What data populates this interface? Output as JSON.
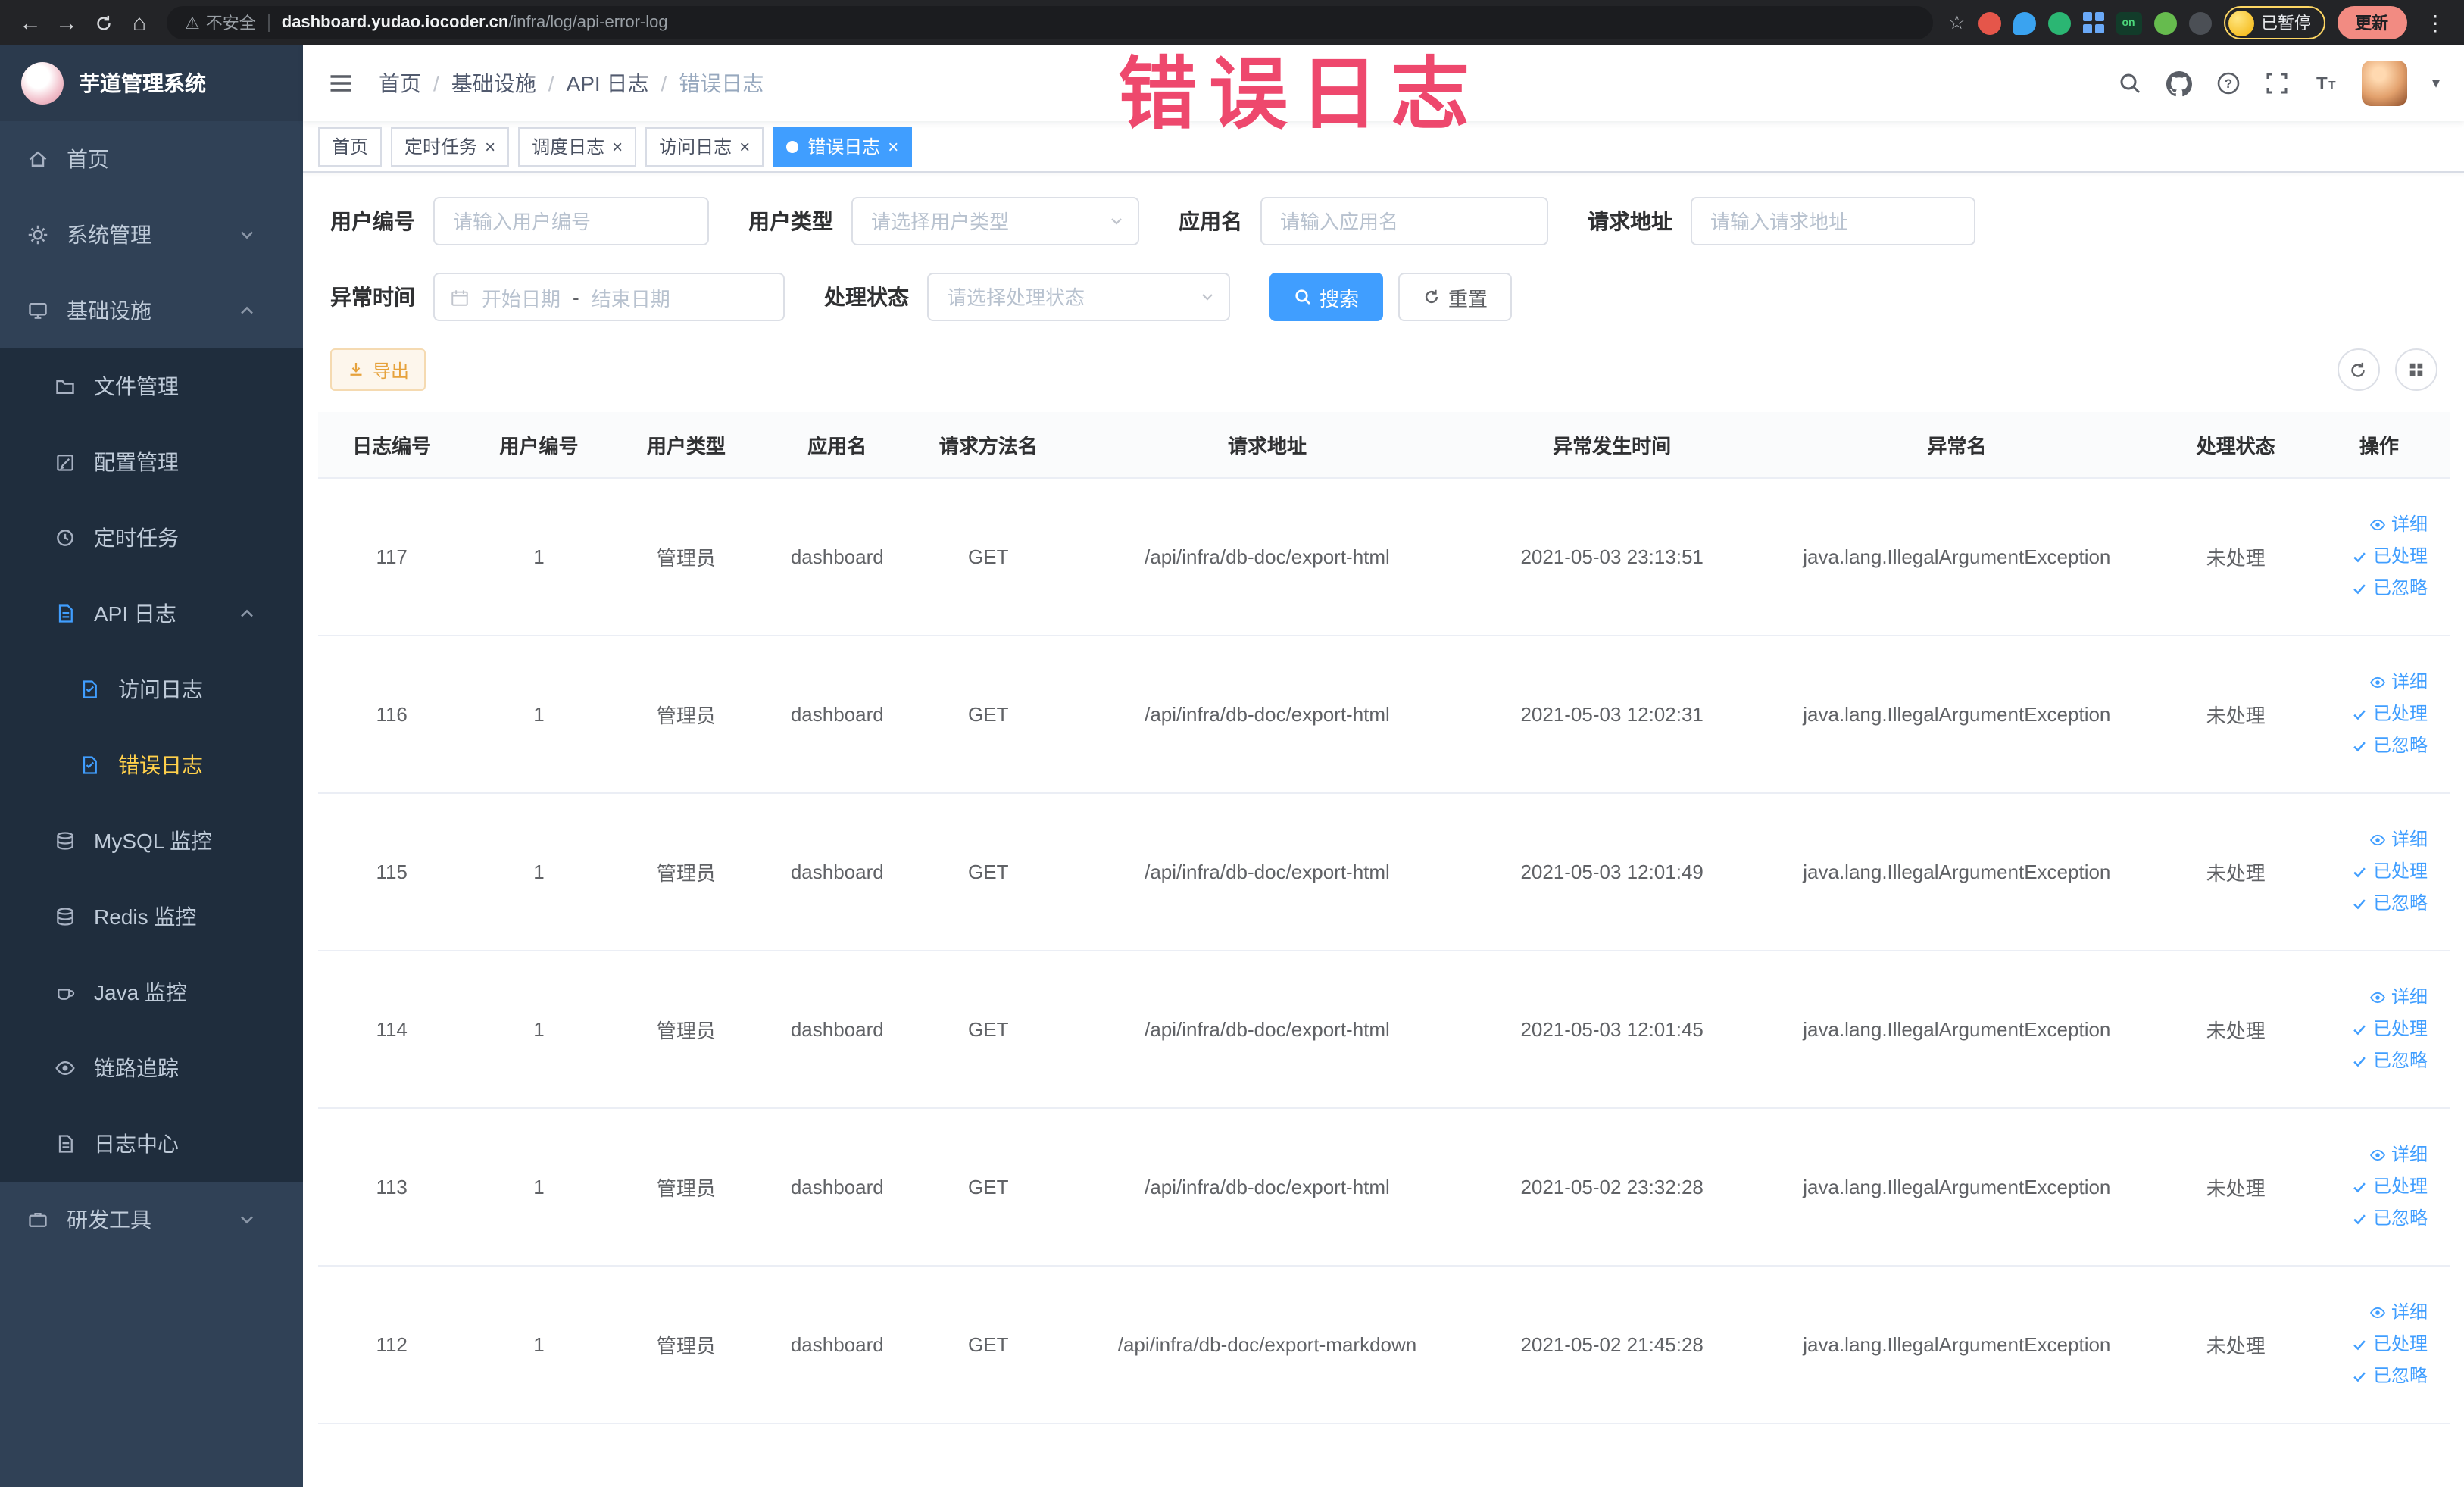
{
  "colors": {
    "primary": "#409EFF",
    "warning": "#E6A23C",
    "sidebar_bg": "#304156",
    "active_menu_text": "#ffd04b",
    "annotation": "#ED3B63",
    "tab_active_bg": "#409EFF"
  },
  "browser": {
    "not_secure": "不安全",
    "url_domain": "dashboard.yudao.iocoder.cn",
    "url_path": "/infra/log/api-error-log",
    "on_badge": "on",
    "paused_label": "已暂停",
    "update_label": "更新"
  },
  "overlay": {
    "text": "错误日志"
  },
  "sidebar": {
    "logo_title": "芋道管理系统",
    "items": [
      {
        "id": "home",
        "label": "首页",
        "icon": "home-icon",
        "level": 1
      },
      {
        "id": "system",
        "label": "系统管理",
        "icon": "gear-icon",
        "level": 1,
        "chevron": "down"
      },
      {
        "id": "infra",
        "label": "基础设施",
        "icon": "monitor-icon",
        "level": 1,
        "chevron": "up"
      },
      {
        "id": "file",
        "label": "文件管理",
        "icon": "folder-icon",
        "level": 2
      },
      {
        "id": "config",
        "label": "配置管理",
        "icon": "edit-icon",
        "level": 2
      },
      {
        "id": "job",
        "label": "定时任务",
        "icon": "clock-icon",
        "level": 2
      },
      {
        "id": "api-log",
        "label": "API 日志",
        "icon": "apidoc-icon",
        "level": 2,
        "chevron": "up",
        "blue": true
      },
      {
        "id": "access-log",
        "label": "访问日志",
        "icon": "doc-icon",
        "level": 3,
        "blue": true
      },
      {
        "id": "error-log",
        "label": "错误日志",
        "icon": "doc-icon",
        "level": 3,
        "blue": true,
        "active": true
      },
      {
        "id": "mysql",
        "label": "MySQL 监控",
        "icon": "db-icon",
        "level": 2
      },
      {
        "id": "redis",
        "label": "Redis 监控",
        "icon": "db-icon",
        "level": 2
      },
      {
        "id": "java",
        "label": "Java 监控",
        "icon": "coffee-icon",
        "level": 2
      },
      {
        "id": "trace",
        "label": "链路追踪",
        "icon": "eye-icon",
        "level": 2
      },
      {
        "id": "log-center",
        "label": "日志中心",
        "icon": "apidoc-icon",
        "level": 2
      },
      {
        "id": "devtools",
        "label": "研发工具",
        "icon": "briefcase-icon",
        "level": 1,
        "chevron": "down"
      }
    ]
  },
  "topbar": {
    "breadcrumb": [
      "首页",
      "基础设施",
      "API 日志",
      "错误日志"
    ]
  },
  "tabs": [
    {
      "label": "首页",
      "closable": false,
      "active": false
    },
    {
      "label": "定时任务",
      "closable": true,
      "active": false
    },
    {
      "label": "调度日志",
      "closable": true,
      "active": false
    },
    {
      "label": "访问日志",
      "closable": true,
      "active": false
    },
    {
      "label": "错误日志",
      "closable": true,
      "active": true
    }
  ],
  "filters": {
    "user_id": {
      "label": "用户编号",
      "placeholder": "请输入用户编号"
    },
    "user_type": {
      "label": "用户类型",
      "placeholder": "请选择用户类型"
    },
    "app_name": {
      "label": "应用名",
      "placeholder": "请输入应用名"
    },
    "request_url": {
      "label": "请求地址",
      "placeholder": "请输入请求地址"
    },
    "exception_time": {
      "label": "异常时间",
      "start_placeholder": "开始日期",
      "separator": "-",
      "end_placeholder": "结束日期"
    },
    "process_status": {
      "label": "处理状态",
      "placeholder": "请选择处理状态"
    },
    "search_button": "搜索",
    "reset_button": "重置"
  },
  "toolbar": {
    "export_button": "导出"
  },
  "table": {
    "columns": [
      "日志编号",
      "用户编号",
      "用户类型",
      "应用名",
      "请求方法名",
      "请求地址",
      "异常发生时间",
      "异常名",
      "处理状态",
      "操作"
    ],
    "action_labels": [
      "详细",
      "已处理",
      "已忽略"
    ],
    "rows": [
      {
        "id": "117",
        "user_id": "1",
        "user_type": "管理员",
        "app": "dashboard",
        "method": "GET",
        "url": "/api/infra/db-doc/export-html",
        "time": "2021-05-03 23:13:51",
        "exception": "java.lang.IllegalArgumentException",
        "status": "未处理"
      },
      {
        "id": "116",
        "user_id": "1",
        "user_type": "管理员",
        "app": "dashboard",
        "method": "GET",
        "url": "/api/infra/db-doc/export-html",
        "time": "2021-05-03 12:02:31",
        "exception": "java.lang.IllegalArgumentException",
        "status": "未处理"
      },
      {
        "id": "115",
        "user_id": "1",
        "user_type": "管理员",
        "app": "dashboard",
        "method": "GET",
        "url": "/api/infra/db-doc/export-html",
        "time": "2021-05-03 12:01:49",
        "exception": "java.lang.IllegalArgumentException",
        "status": "未处理"
      },
      {
        "id": "114",
        "user_id": "1",
        "user_type": "管理员",
        "app": "dashboard",
        "method": "GET",
        "url": "/api/infra/db-doc/export-html",
        "time": "2021-05-03 12:01:45",
        "exception": "java.lang.IllegalArgumentException",
        "status": "未处理"
      },
      {
        "id": "113",
        "user_id": "1",
        "user_type": "管理员",
        "app": "dashboard",
        "method": "GET",
        "url": "/api/infra/db-doc/export-html",
        "time": "2021-05-02 23:32:28",
        "exception": "java.lang.IllegalArgumentException",
        "status": "未处理"
      },
      {
        "id": "112",
        "user_id": "1",
        "user_type": "管理员",
        "app": "dashboard",
        "method": "GET",
        "url": "/api/infra/db-doc/export-markdown",
        "time": "2021-05-02 21:45:28",
        "exception": "java.lang.IllegalArgumentException",
        "status": "未处理"
      }
    ]
  }
}
